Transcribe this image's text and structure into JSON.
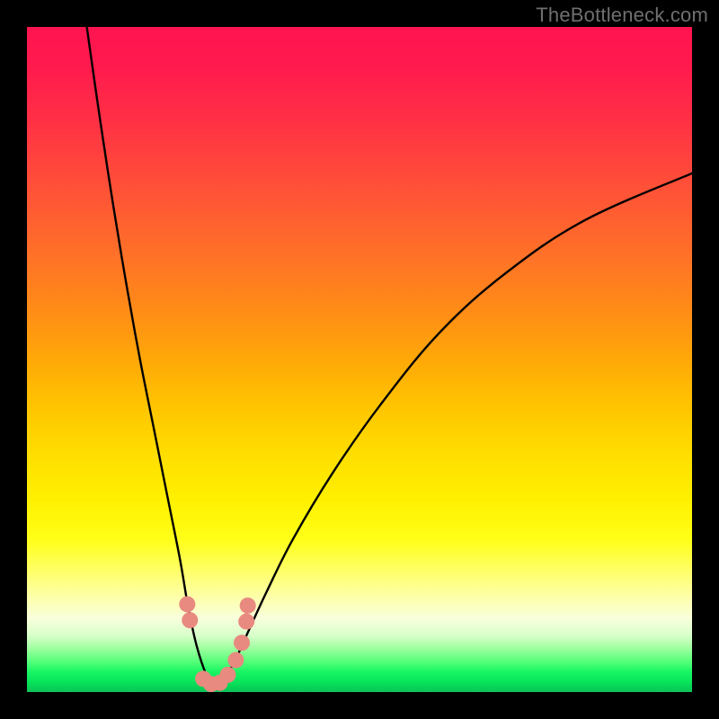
{
  "watermark": {
    "text": "TheBottleneck.com"
  },
  "chart_data": {
    "type": "line",
    "title": "",
    "xlabel": "",
    "ylabel": "",
    "xlim": [
      0,
      100
    ],
    "ylim": [
      0,
      100
    ],
    "note": "V-shaped bottleneck curve; y≈100 = worst (red), y≈0 = best (green). Minimum near x≈28.",
    "series": [
      {
        "name": "left-branch",
        "x": [
          9,
          11,
          13,
          15,
          17,
          19,
          21,
          23,
          24.2,
          25.5,
          27,
          28
        ],
        "y": [
          100,
          86,
          73,
          61,
          50,
          40,
          30,
          20,
          13,
          7,
          2.5,
          1.2
        ]
      },
      {
        "name": "right-branch",
        "x": [
          28,
          29.5,
          31,
          33,
          36,
          40,
          46,
          53,
          62,
          72,
          84,
          100
        ],
        "y": [
          1.2,
          2.3,
          4.2,
          8.5,
          15,
          23,
          33,
          43,
          54,
          63,
          71,
          78
        ]
      },
      {
        "name": "markers",
        "marker": "circle",
        "color": "#e88a80",
        "x": [
          24.1,
          24.5,
          26.5,
          27.7,
          29.0,
          30.2,
          31.4,
          32.3,
          33.0,
          33.2
        ],
        "y": [
          13.2,
          10.8,
          2.0,
          1.2,
          1.4,
          2.6,
          4.8,
          7.4,
          10.6,
          13.0
        ]
      }
    ]
  }
}
